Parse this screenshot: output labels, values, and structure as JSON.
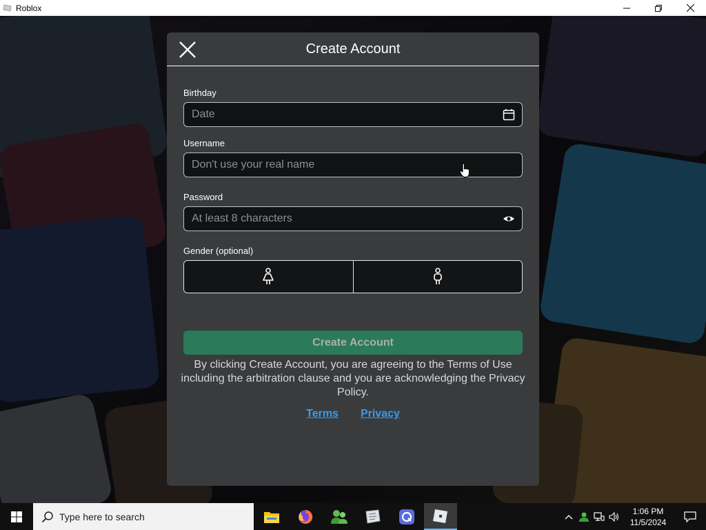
{
  "window": {
    "title": "Roblox"
  },
  "modal": {
    "title": "Create Account",
    "birthday": {
      "label": "Birthday",
      "placeholder": "Date"
    },
    "username": {
      "label": "Username",
      "placeholder": "Don't use your real name"
    },
    "password": {
      "label": "Password",
      "placeholder": "At least 8 characters"
    },
    "gender": {
      "label": "Gender (optional)",
      "options": [
        "female-icon",
        "male-icon"
      ]
    },
    "create_button": "Create Account",
    "legal_text": "By clicking Create Account, you are agreeing to the Terms of Use including the arbitration clause and you are acknowledging the Privacy Policy.",
    "links": {
      "terms": "Terms",
      "privacy": "Privacy"
    }
  },
  "taskbar": {
    "search_placeholder": "Type here to search",
    "apps": [
      "file-explorer-icon",
      "firefox-icon",
      "people-app-icon",
      "roblox-studio-icon",
      "app-icon",
      "roblox-icon"
    ],
    "time": "1:06 PM",
    "date": "11/5/2024"
  },
  "colors": {
    "accent": "#2b7a5a",
    "link": "#3d9be9",
    "modal_bg": "#393b3d"
  }
}
